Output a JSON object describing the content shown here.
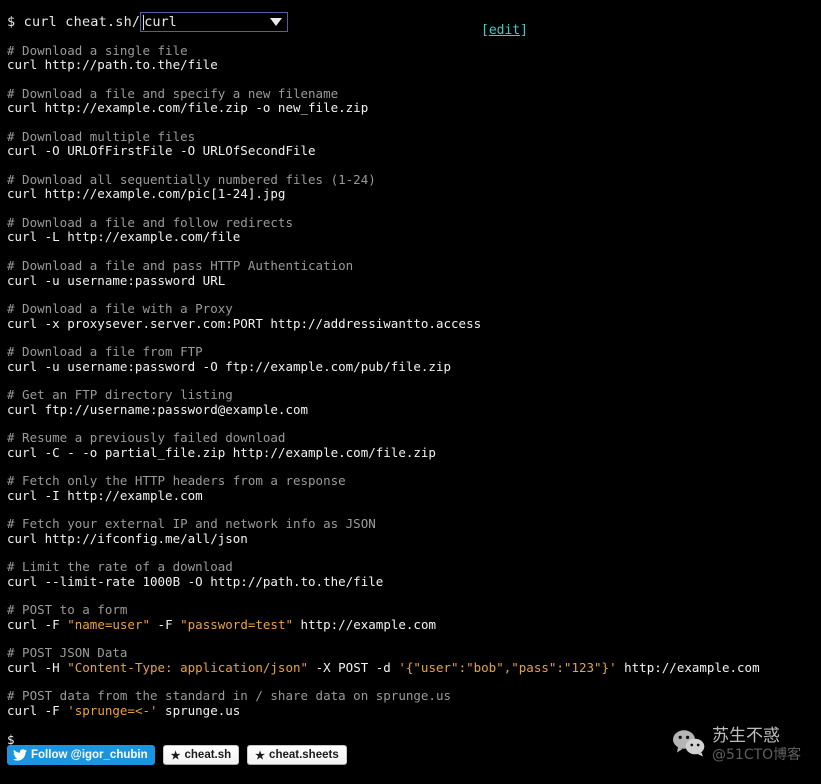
{
  "prompt": {
    "shell_prefix": "$ curl cheat.sh/",
    "query_value": "curl",
    "query_placeholder": "curl",
    "dropdown_icon": "chevron-down-icon"
  },
  "edit": {
    "open_bracket": "[",
    "label": "edit",
    "close_bracket": "]"
  },
  "colors": {
    "background": "#000000",
    "comment": "#9a9a9a",
    "command": "#f2f2f2",
    "string": "#e8a33d",
    "link": "#35d0d0",
    "input_border": "#4f5fa8",
    "twitter_blue": "#1b95e0"
  },
  "terminal": {
    "blocks": [
      {
        "comment": "# Download a single file",
        "command": [
          {
            "t": "curl http://path.to.the/file",
            "c": "cmd"
          }
        ]
      },
      {
        "comment": "# Download a file and specify a new filename",
        "command": [
          {
            "t": "curl http://example.com/file.zip -o new_file.zip",
            "c": "cmd"
          }
        ]
      },
      {
        "comment": "# Download multiple files",
        "command": [
          {
            "t": "curl -O URLOfFirstFile -O URLOfSecondFile",
            "c": "cmd"
          }
        ]
      },
      {
        "comment": "# Download all sequentially numbered files (1-24)",
        "command": [
          {
            "t": "curl http://example.com/pic[1-24].jpg",
            "c": "cmd"
          }
        ]
      },
      {
        "comment": "# Download a file and follow redirects",
        "command": [
          {
            "t": "curl -L http://example.com/file",
            "c": "cmd"
          }
        ]
      },
      {
        "comment": "# Download a file and pass HTTP Authentication",
        "command": [
          {
            "t": "curl -u username:password URL",
            "c": "cmd"
          }
        ]
      },
      {
        "comment": "# Download a file with a Proxy",
        "command": [
          {
            "t": "curl -x proxysever.server.com:PORT http://addressiwantto.access",
            "c": "cmd"
          }
        ]
      },
      {
        "comment": "# Download a file from FTP",
        "command": [
          {
            "t": "curl -u username:password -O ftp://example.com/pub/file.zip",
            "c": "cmd"
          }
        ]
      },
      {
        "comment": "# Get an FTP directory listing",
        "command": [
          {
            "t": "curl ftp://username:password@example.com",
            "c": "cmd"
          }
        ]
      },
      {
        "comment": "# Resume a previously failed download",
        "command": [
          {
            "t": "curl -C - -o partial_file.zip http://example.com/file.zip",
            "c": "cmd"
          }
        ]
      },
      {
        "comment": "# Fetch only the HTTP headers from a response",
        "command": [
          {
            "t": "curl -I http://example.com",
            "c": "cmd"
          }
        ]
      },
      {
        "comment": "# Fetch your external IP and network info as JSON",
        "command": [
          {
            "t": "curl http://ifconfig.me/all/json",
            "c": "cmd"
          }
        ]
      },
      {
        "comment": "# Limit the rate of a download",
        "command": [
          {
            "t": "curl --limit-rate 1000B -O http://path.to.the/file",
            "c": "cmd"
          }
        ]
      },
      {
        "comment": "# POST to a form",
        "command": [
          {
            "t": "curl -F ",
            "c": "cmd"
          },
          {
            "t": "\"name=user\"",
            "c": "str"
          },
          {
            "t": " -F ",
            "c": "cmd"
          },
          {
            "t": "\"password=test\"",
            "c": "str"
          },
          {
            "t": " http://example.com",
            "c": "cmd"
          }
        ]
      },
      {
        "comment": "# POST JSON Data",
        "command": [
          {
            "t": "curl -H ",
            "c": "cmd"
          },
          {
            "t": "\"Content-Type: application/json\"",
            "c": "str"
          },
          {
            "t": " -X POST -d ",
            "c": "cmd"
          },
          {
            "t": "'{\"user\":\"bob\",\"pass\":\"123\"}'",
            "c": "str"
          },
          {
            "t": " http://example.com",
            "c": "cmd"
          }
        ]
      },
      {
        "comment": "# POST data from the standard in / share data on sprunge.us",
        "command": [
          {
            "t": "curl -F ",
            "c": "cmd"
          },
          {
            "t": "'sprunge=<-'",
            "c": "str"
          },
          {
            "t": " sprunge.us",
            "c": "cmd"
          }
        ]
      }
    ],
    "end_prompt": "$"
  },
  "social": {
    "twitter": {
      "icon": "twitter-bird-icon",
      "label": "Follow @igor_chubin"
    },
    "buttons": [
      {
        "icon": "star-icon",
        "label": "cheat.sh"
      },
      {
        "icon": "star-icon",
        "label": "cheat.sheets"
      }
    ]
  },
  "watermark": {
    "icon": "wechat-icon",
    "name": "苏生不惑",
    "handle": "@51CTO博客"
  }
}
